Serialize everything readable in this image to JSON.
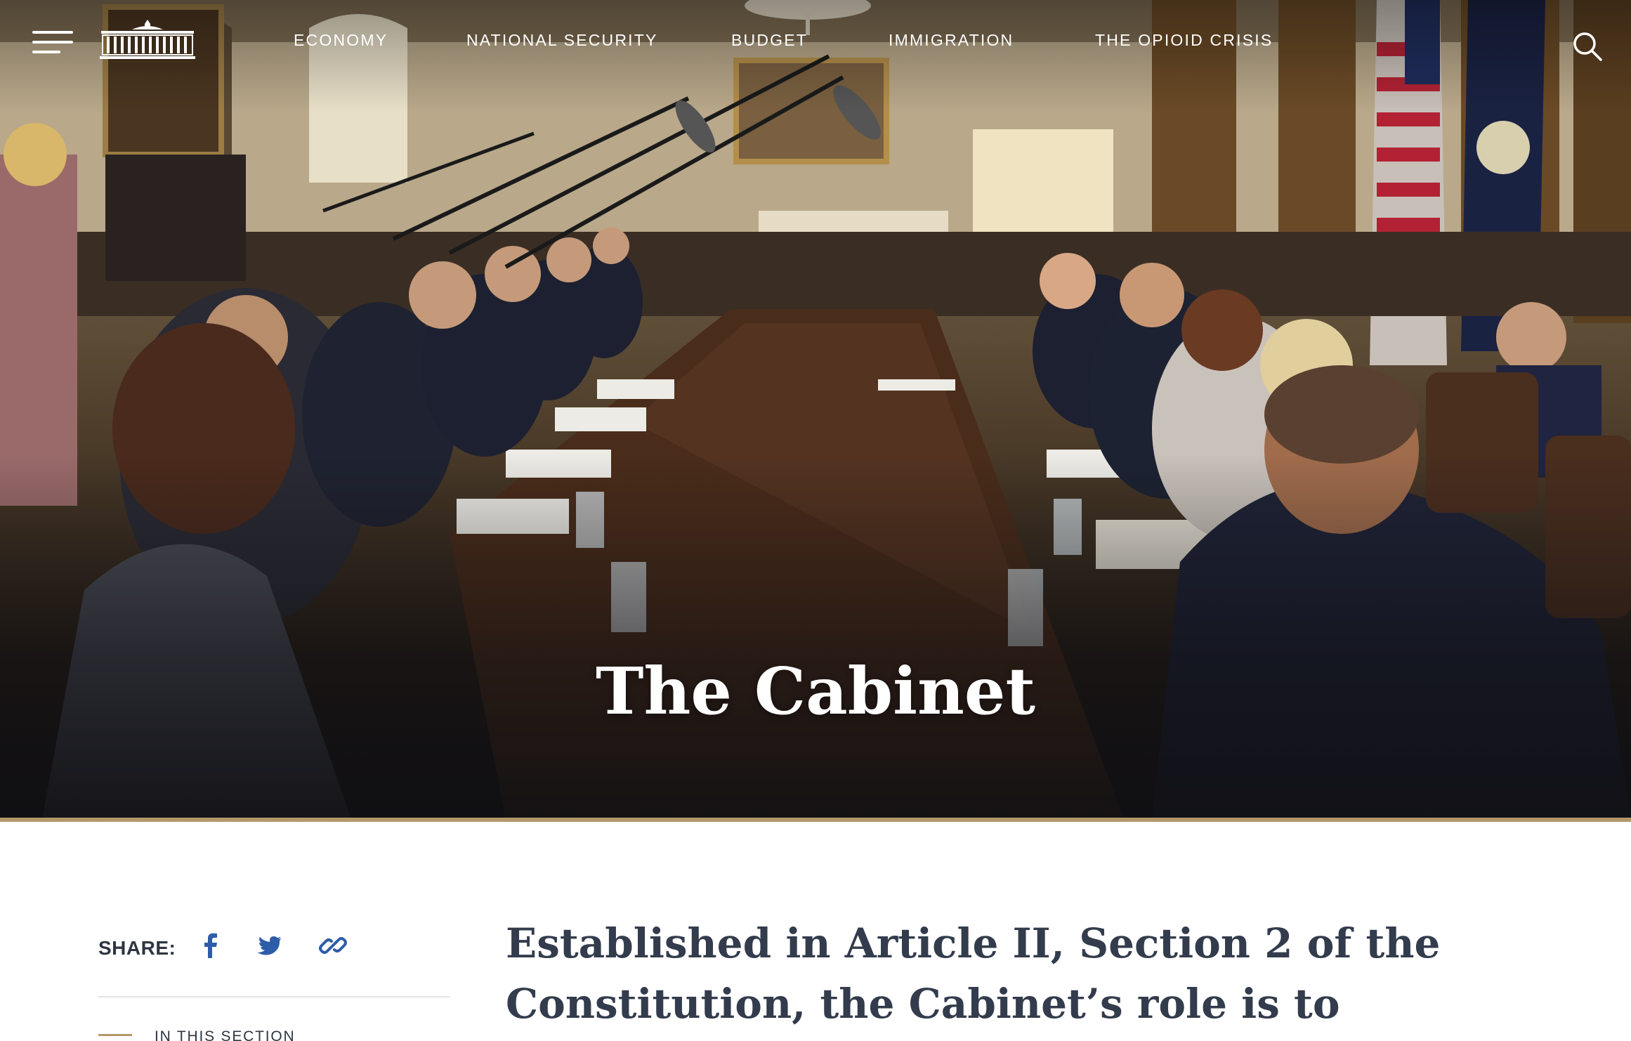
{
  "header": {
    "menu_icon": "hamburger-menu-icon",
    "logo_icon": "white-house-logo-icon",
    "nav": [
      {
        "label": "ECONOMY"
      },
      {
        "label": "NATIONAL SECURITY"
      },
      {
        "label": "BUDGET"
      },
      {
        "label": "IMMIGRATION"
      },
      {
        "label": "THE OPIOID CRISIS"
      }
    ],
    "search_icon": "search-icon"
  },
  "hero": {
    "title": "The Cabinet",
    "accent_color": "#b4976a"
  },
  "share": {
    "label": "SHARE:",
    "buttons": [
      {
        "icon": "facebook-icon",
        "color": "#2d5da8"
      },
      {
        "icon": "twitter-icon",
        "color": "#2d5da8"
      },
      {
        "icon": "link-icon",
        "color": "#2d5da8"
      }
    ]
  },
  "sidebar": {
    "section_label": "IN THIS SECTION"
  },
  "main": {
    "intro_lines": [
      "Established in Article II, Section 2 of the",
      "Constitution, the Cabinet’s role is to"
    ]
  }
}
